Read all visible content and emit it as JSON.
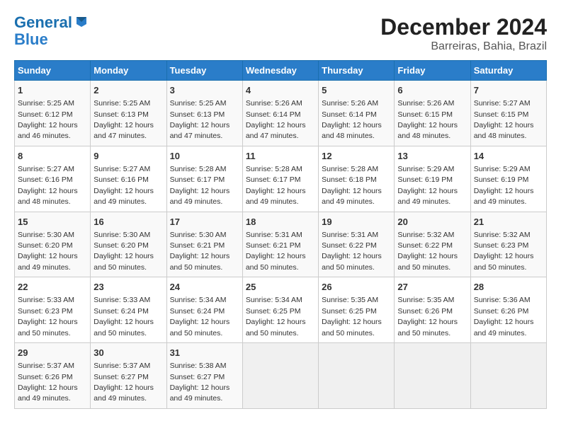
{
  "logo": {
    "line1": "General",
    "line2": "Blue"
  },
  "title": "December 2024",
  "subtitle": "Barreiras, Bahia, Brazil",
  "days_header": [
    "Sunday",
    "Monday",
    "Tuesday",
    "Wednesday",
    "Thursday",
    "Friday",
    "Saturday"
  ],
  "weeks": [
    [
      {
        "day": "1",
        "info": "Sunrise: 5:25 AM\nSunset: 6:12 PM\nDaylight: 12 hours\nand 46 minutes."
      },
      {
        "day": "2",
        "info": "Sunrise: 5:25 AM\nSunset: 6:13 PM\nDaylight: 12 hours\nand 47 minutes."
      },
      {
        "day": "3",
        "info": "Sunrise: 5:25 AM\nSunset: 6:13 PM\nDaylight: 12 hours\nand 47 minutes."
      },
      {
        "day": "4",
        "info": "Sunrise: 5:26 AM\nSunset: 6:14 PM\nDaylight: 12 hours\nand 47 minutes."
      },
      {
        "day": "5",
        "info": "Sunrise: 5:26 AM\nSunset: 6:14 PM\nDaylight: 12 hours\nand 48 minutes."
      },
      {
        "day": "6",
        "info": "Sunrise: 5:26 AM\nSunset: 6:15 PM\nDaylight: 12 hours\nand 48 minutes."
      },
      {
        "day": "7",
        "info": "Sunrise: 5:27 AM\nSunset: 6:15 PM\nDaylight: 12 hours\nand 48 minutes."
      }
    ],
    [
      {
        "day": "8",
        "info": "Sunrise: 5:27 AM\nSunset: 6:16 PM\nDaylight: 12 hours\nand 48 minutes."
      },
      {
        "day": "9",
        "info": "Sunrise: 5:27 AM\nSunset: 6:16 PM\nDaylight: 12 hours\nand 49 minutes."
      },
      {
        "day": "10",
        "info": "Sunrise: 5:28 AM\nSunset: 6:17 PM\nDaylight: 12 hours\nand 49 minutes."
      },
      {
        "day": "11",
        "info": "Sunrise: 5:28 AM\nSunset: 6:17 PM\nDaylight: 12 hours\nand 49 minutes."
      },
      {
        "day": "12",
        "info": "Sunrise: 5:28 AM\nSunset: 6:18 PM\nDaylight: 12 hours\nand 49 minutes."
      },
      {
        "day": "13",
        "info": "Sunrise: 5:29 AM\nSunset: 6:19 PM\nDaylight: 12 hours\nand 49 minutes."
      },
      {
        "day": "14",
        "info": "Sunrise: 5:29 AM\nSunset: 6:19 PM\nDaylight: 12 hours\nand 49 minutes."
      }
    ],
    [
      {
        "day": "15",
        "info": "Sunrise: 5:30 AM\nSunset: 6:20 PM\nDaylight: 12 hours\nand 49 minutes."
      },
      {
        "day": "16",
        "info": "Sunrise: 5:30 AM\nSunset: 6:20 PM\nDaylight: 12 hours\nand 50 minutes."
      },
      {
        "day": "17",
        "info": "Sunrise: 5:30 AM\nSunset: 6:21 PM\nDaylight: 12 hours\nand 50 minutes."
      },
      {
        "day": "18",
        "info": "Sunrise: 5:31 AM\nSunset: 6:21 PM\nDaylight: 12 hours\nand 50 minutes."
      },
      {
        "day": "19",
        "info": "Sunrise: 5:31 AM\nSunset: 6:22 PM\nDaylight: 12 hours\nand 50 minutes."
      },
      {
        "day": "20",
        "info": "Sunrise: 5:32 AM\nSunset: 6:22 PM\nDaylight: 12 hours\nand 50 minutes."
      },
      {
        "day": "21",
        "info": "Sunrise: 5:32 AM\nSunset: 6:23 PM\nDaylight: 12 hours\nand 50 minutes."
      }
    ],
    [
      {
        "day": "22",
        "info": "Sunrise: 5:33 AM\nSunset: 6:23 PM\nDaylight: 12 hours\nand 50 minutes."
      },
      {
        "day": "23",
        "info": "Sunrise: 5:33 AM\nSunset: 6:24 PM\nDaylight: 12 hours\nand 50 minutes."
      },
      {
        "day": "24",
        "info": "Sunrise: 5:34 AM\nSunset: 6:24 PM\nDaylight: 12 hours\nand 50 minutes."
      },
      {
        "day": "25",
        "info": "Sunrise: 5:34 AM\nSunset: 6:25 PM\nDaylight: 12 hours\nand 50 minutes."
      },
      {
        "day": "26",
        "info": "Sunrise: 5:35 AM\nSunset: 6:25 PM\nDaylight: 12 hours\nand 50 minutes."
      },
      {
        "day": "27",
        "info": "Sunrise: 5:35 AM\nSunset: 6:26 PM\nDaylight: 12 hours\nand 50 minutes."
      },
      {
        "day": "28",
        "info": "Sunrise: 5:36 AM\nSunset: 6:26 PM\nDaylight: 12 hours\nand 49 minutes."
      }
    ],
    [
      {
        "day": "29",
        "info": "Sunrise: 5:37 AM\nSunset: 6:26 PM\nDaylight: 12 hours\nand 49 minutes."
      },
      {
        "day": "30",
        "info": "Sunrise: 5:37 AM\nSunset: 6:27 PM\nDaylight: 12 hours\nand 49 minutes."
      },
      {
        "day": "31",
        "info": "Sunrise: 5:38 AM\nSunset: 6:27 PM\nDaylight: 12 hours\nand 49 minutes."
      },
      null,
      null,
      null,
      null
    ]
  ]
}
